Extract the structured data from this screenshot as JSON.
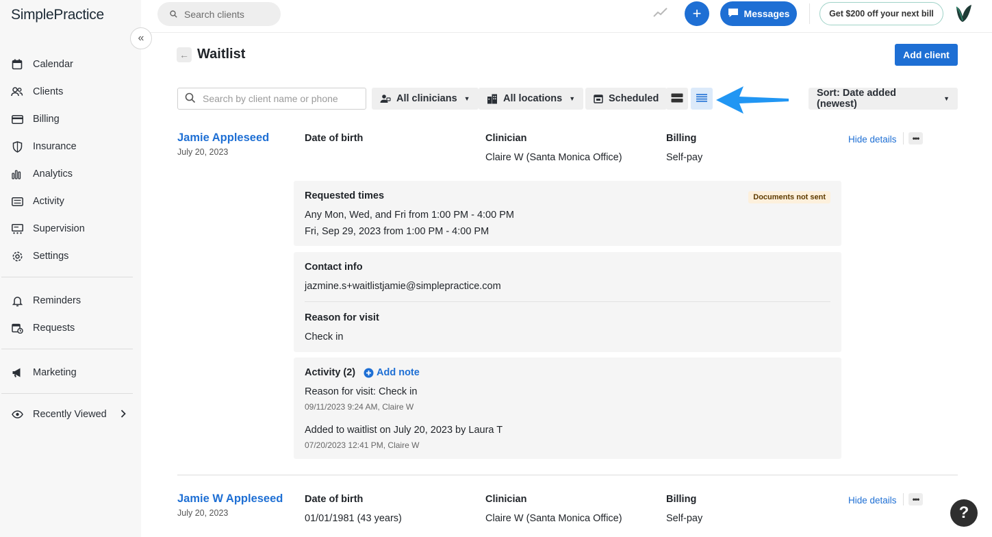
{
  "app": {
    "logo": "SimplePractice"
  },
  "sidebar": {
    "collapse_icon": "«",
    "items": [
      {
        "label": "Calendar",
        "icon": "calendar-icon"
      },
      {
        "label": "Clients",
        "icon": "users-icon"
      },
      {
        "label": "Billing",
        "icon": "credit-card-icon"
      },
      {
        "label": "Insurance",
        "icon": "shield-icon"
      },
      {
        "label": "Analytics",
        "icon": "bar-chart-icon"
      },
      {
        "label": "Activity",
        "icon": "list-icon"
      },
      {
        "label": "Supervision",
        "icon": "supervision-icon"
      },
      {
        "label": "Settings",
        "icon": "gear-icon"
      },
      {
        "label": "Reminders",
        "icon": "bell-icon"
      },
      {
        "label": "Requests",
        "icon": "calendar-request-icon"
      },
      {
        "label": "Marketing",
        "icon": "megaphone-icon"
      },
      {
        "label": "Recently Viewed",
        "icon": "eye-icon"
      }
    ]
  },
  "topbar": {
    "search_placeholder": "Search clients",
    "plus_label": "+",
    "messages_label": "Messages",
    "promo_label": "Get $200 off your next bill"
  },
  "page": {
    "title": "Waitlist",
    "back_icon": "←",
    "add_client_label": "Add client"
  },
  "filters": {
    "search_placeholder": "Search by client name or phone",
    "clinicians_label": "All clinicians",
    "locations_label": "All locations",
    "scheduled_label": "Scheduled",
    "sort_label": "Sort: Date added (newest)"
  },
  "clients": [
    {
      "name": "Jamie Appleseed",
      "date": "July 20, 2023",
      "dob_label": "Date of birth",
      "dob_value": "",
      "clinician_label": "Clinician",
      "clinician_value": "Claire W (Santa Monica Office)",
      "billing_label": "Billing",
      "billing_value": "Self-pay",
      "hide_details_label": "Hide details",
      "more_label": "•••",
      "requested_times": {
        "title": "Requested times",
        "badge": "Documents not sent",
        "lines": [
          "Any Mon, Wed, and Fri from 1:00 PM - 4:00 PM",
          "Fri, Sep 29, 2023 from 1:00 PM - 4:00 PM"
        ]
      },
      "contact": {
        "title": "Contact info",
        "email": "jazmine.s+waitlistjamie@simplepractice.com",
        "reason_title": "Reason for visit",
        "reason": "Check in"
      },
      "activity": {
        "title": "Activity (2)",
        "add_note_label": "Add note",
        "entries": [
          {
            "text": "Reason for visit: Check in",
            "meta": "09/11/2023 9:24 AM, Claire W"
          },
          {
            "text": "Added to waitlist on July 20, 2023 by Laura T",
            "meta": "07/20/2023 12:41 PM, Claire W"
          }
        ]
      }
    },
    {
      "name": "Jamie W Appleseed",
      "date": "July 20, 2023",
      "dob_label": "Date of birth",
      "dob_value": "01/01/1981 (43 years)",
      "clinician_label": "Clinician",
      "clinician_value": "Claire W (Santa Monica Office)",
      "billing_label": "Billing",
      "billing_value": "Self-pay",
      "hide_details_label": "Hide details",
      "more_label": "•••"
    }
  ],
  "help": {
    "label": "?"
  },
  "colors": {
    "accent": "#1e6fd4",
    "sidebar_bg": "#f7f7f7",
    "panel_bg": "#f5f5f5",
    "arrow": "#2196f3"
  }
}
